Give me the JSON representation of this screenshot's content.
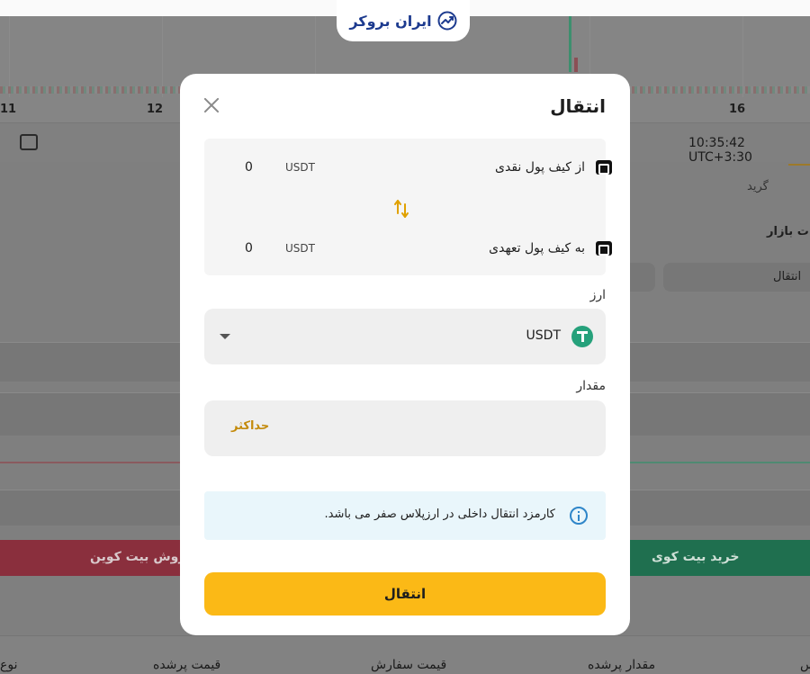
{
  "brand": {
    "logo_text": "ایران بروکر"
  },
  "background": {
    "chart_dates": [
      "11",
      "12",
      "16"
    ],
    "time": "10:35:42 UTC+3:30",
    "tabs": {
      "grid": "گرید"
    },
    "market_label": "ت بازار",
    "transfer_button": "انتقال",
    "sell_button": "روش بیت کوین",
    "buy_button": "خرید بیت کوی",
    "columns": [
      "نوع",
      "قیمت پرشده",
      "قیمت سفارش",
      "مقدار پرشده",
      "س"
    ]
  },
  "modal": {
    "title": "انتقال",
    "from_wallet": {
      "name": "از کیف پول نقدی",
      "amount": "0",
      "unit": "USDT"
    },
    "to_wallet": {
      "name": "به کیف پول تعهدی",
      "amount": "0",
      "unit": "USDT"
    },
    "currency_label": "ارز",
    "currency_value": "USDT",
    "amount_label": "مقدار",
    "amount_value": "",
    "max_label": "حداکثر",
    "info_text": "کارمزد انتقال داخلی در ارزپلاس صفر می باشد.",
    "submit_label": "انتقال"
  },
  "colors": {
    "accent": "#fbb916",
    "max_link": "#c48b0c",
    "info_bg": "#e9f6fb",
    "info_icon": "#2f86c9",
    "tether": "#26a17b",
    "sell": "#c9344a",
    "buy": "#1e9c6a"
  }
}
